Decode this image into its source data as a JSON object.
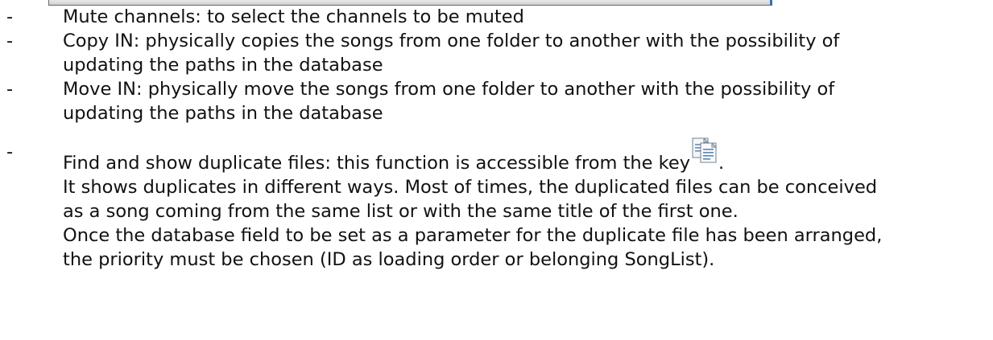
{
  "items": [
    {
      "dash": "-",
      "lines": [
        "Mute channels: to select the channels to be muted"
      ]
    },
    {
      "dash": "-",
      "lines": [
        "Copy IN: physically copies the songs from one folder to another with the possibility of",
        "updating the paths in the database"
      ]
    },
    {
      "dash": "-",
      "lines": [
        "Move IN: physically move the songs from one folder to another with the possibility of",
        "updating the paths in the database"
      ]
    }
  ],
  "duplicates": {
    "dash": "-",
    "intro": "Find and show duplicate files: this function is accessible from the key",
    "intro_end": ".",
    "icon": "duplicate-files-icon",
    "lines": [
      "It shows duplicates in different ways. Most of times, the duplicated files can be conceived",
      "as a song coming from the same list or with the same title of the first one.",
      "Once the database field to be set as a parameter for the duplicate file has been arranged,",
      "the priority must be chosen (ID as loading order or belonging SongList)."
    ]
  }
}
